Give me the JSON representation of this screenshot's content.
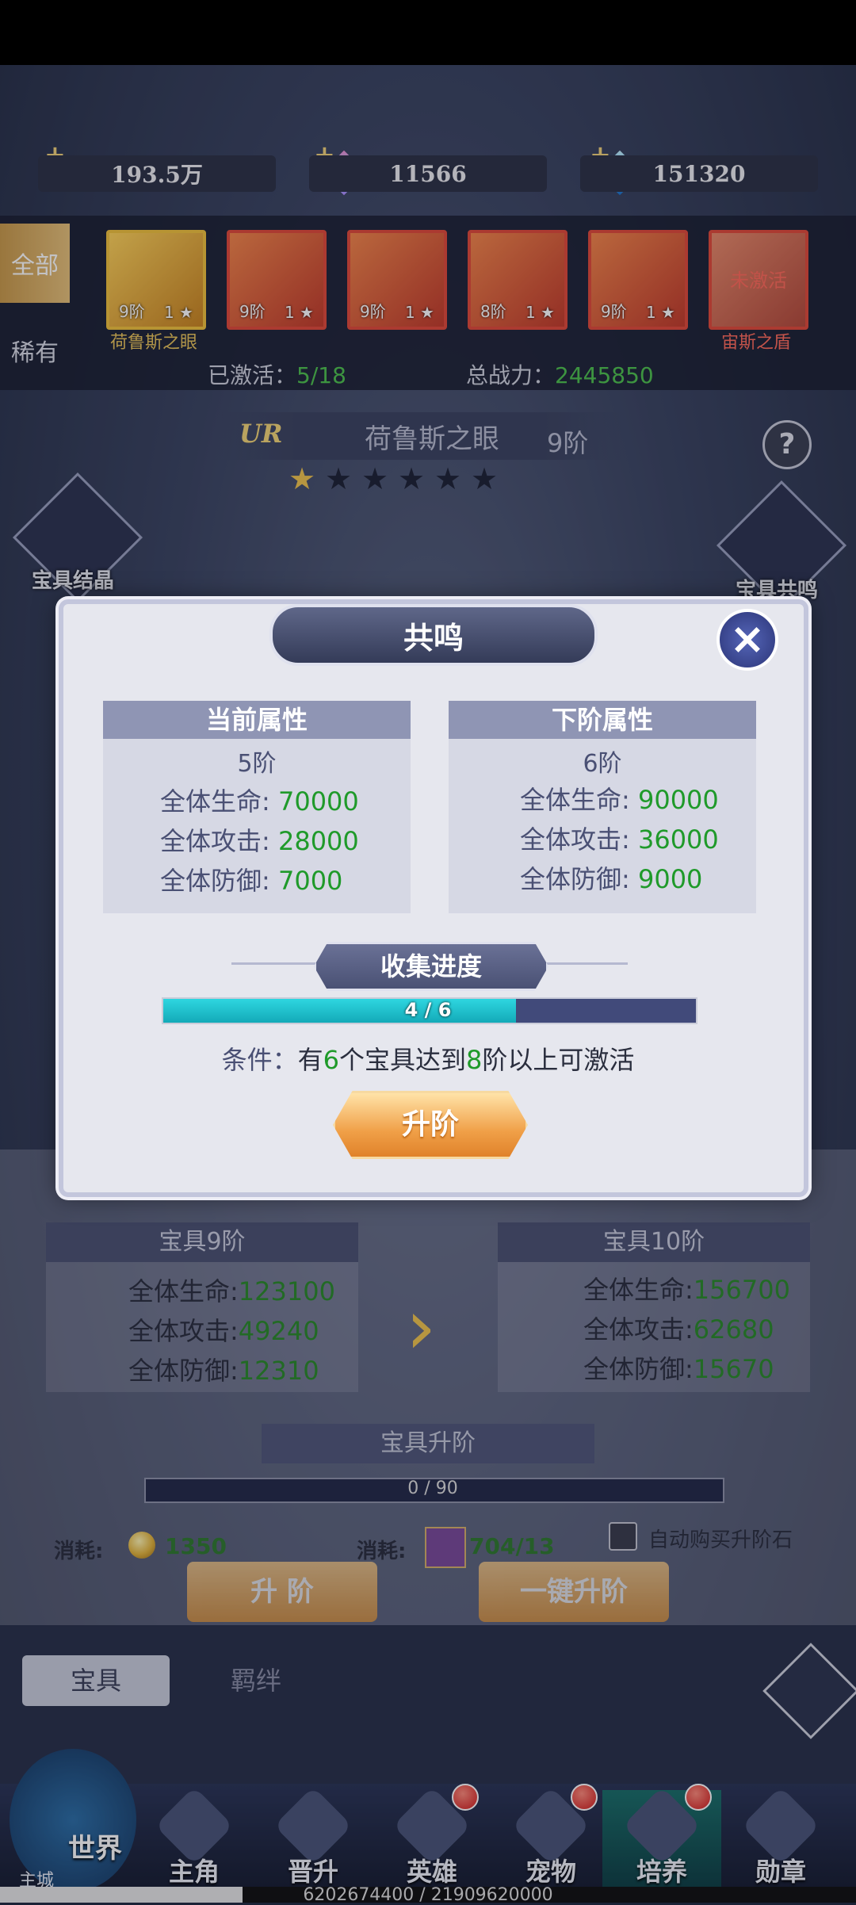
{
  "currencies": {
    "gold": "193.5万",
    "crystal": "11566",
    "diamond": "151320"
  },
  "filter_tabs": {
    "all": "全部",
    "rare": "稀有"
  },
  "items": [
    {
      "grade": "9阶",
      "level": "1",
      "name": "荷鲁斯之眼",
      "gold": true
    },
    {
      "grade": "9阶",
      "level": "1",
      "name": "",
      "gold": false
    },
    {
      "grade": "9阶",
      "level": "1",
      "name": "",
      "gold": false
    },
    {
      "grade": "8阶",
      "level": "1",
      "name": "",
      "gold": false
    },
    {
      "grade": "9阶",
      "level": "1",
      "name": "",
      "gold": false
    },
    {
      "grade": "",
      "level": "",
      "name": "宙斯之盾",
      "gold": false,
      "badge": "未激活"
    }
  ],
  "panel_stats": {
    "activated_label": "已激活：",
    "activated_value": "5/18",
    "power_label": "总战力：",
    "power_value": "2445850"
  },
  "selected": {
    "rarity": "UR",
    "name": "荷鲁斯之眼",
    "grade": "9阶",
    "stars_total": 6,
    "stars_filled": 1
  },
  "side_buttons": {
    "crystal": "宝具结晶",
    "resonance": "宝具共鸣"
  },
  "lower": {
    "current_head": "宝具9阶",
    "current": [
      {
        "label": "全体生命:",
        "value": "123100"
      },
      {
        "label": "全体攻击:",
        "value": "49240"
      },
      {
        "label": "全体防御:",
        "value": "12310"
      }
    ],
    "next_head": "宝具10阶",
    "next": [
      {
        "label": "全体生命:",
        "value": "156700"
      },
      {
        "label": "全体攻击:",
        "value": "62680"
      },
      {
        "label": "全体防御:",
        "value": "15670"
      }
    ],
    "upgrade_title": "宝具升阶",
    "upgrade_progress": "0 / 90",
    "cost_label": "消耗:",
    "cost_gold": "1350",
    "cost_stone": "704/13",
    "upgrade_btn": "升 阶",
    "oneclick_btn": "一键升阶",
    "auto_buy": "自动购买升阶石"
  },
  "bottom_tabs": {
    "treasure": "宝具",
    "bond": "羁绊"
  },
  "nav": [
    {
      "label": "主角"
    },
    {
      "label": "晋升"
    },
    {
      "label": "英雄"
    },
    {
      "label": "宠物"
    },
    {
      "label": "培养"
    },
    {
      "label": "勋章"
    }
  ],
  "world": {
    "label": "世界",
    "sub": "主城"
  },
  "bottom_progress": "6202674400 / 21909620000",
  "modal": {
    "title": "共鸣",
    "current": {
      "head": "当前属性",
      "grade": "5阶",
      "stats": [
        {
          "label": "全体生命: ",
          "value": "70000"
        },
        {
          "label": "全体攻击: ",
          "value": "28000"
        },
        {
          "label": "全体防御: ",
          "value": "7000"
        }
      ]
    },
    "next": {
      "head": "下阶属性",
      "grade": "6阶",
      "stats": [
        {
          "label": "全体生命: ",
          "value": "90000"
        },
        {
          "label": "全体攻击: ",
          "value": "36000"
        },
        {
          "label": "全体防御: ",
          "value": "9000"
        }
      ]
    },
    "collect_title": "收集进度",
    "progress_text": "4 / 6",
    "progress_fraction": 0.6667,
    "condition_label": "条件：",
    "condition_pre": "有",
    "condition_n1": "6",
    "condition_mid": "个宝具达到",
    "condition_n2": "8",
    "condition_post": "阶以上可激活",
    "button": "升阶"
  }
}
